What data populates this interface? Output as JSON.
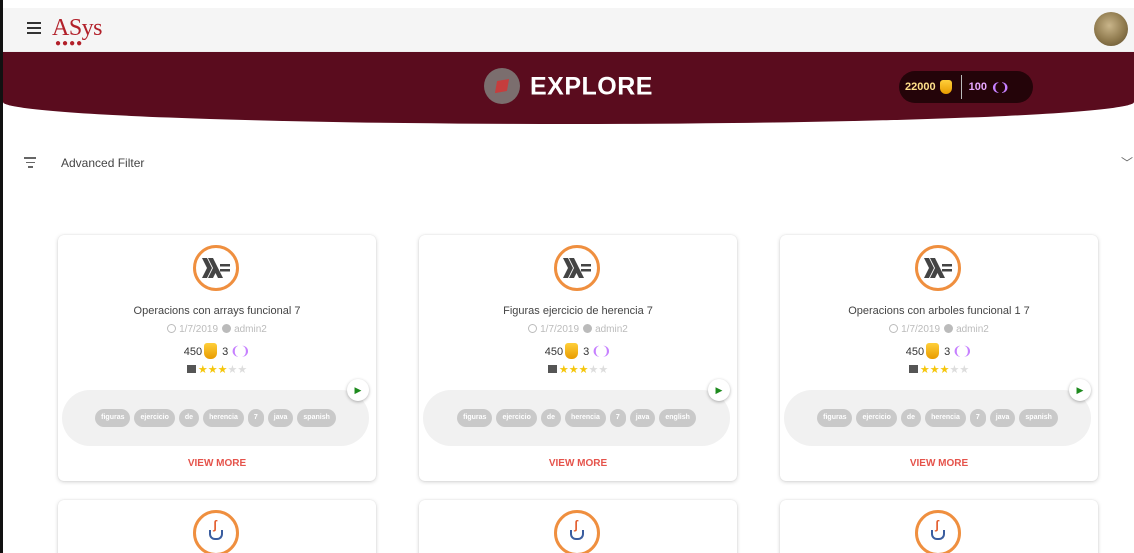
{
  "app": {
    "logo": "ASys",
    "logo_dots": "●●●●",
    "brand_color": "#b2202a"
  },
  "header": {
    "title": "EXPLORE",
    "banner_color": "#5a0c1e",
    "coins": "22000",
    "lives": "100"
  },
  "filter": {
    "label": "Advanced Filter"
  },
  "cards": [
    {
      "title": "Operacions con arrays funcional 7",
      "date": "1/7/2019",
      "author": "admin2",
      "coins": "450",
      "lives": "3",
      "rating": 3,
      "tags": [
        "figuras",
        "ejercicio",
        "de",
        "herencia",
        "7",
        "java",
        "spanish"
      ],
      "cta": "VIEW MORE",
      "icon": "haskell-icon"
    },
    {
      "title": "Figuras ejercicio de herencia 7",
      "date": "1/7/2019",
      "author": "admin2",
      "coins": "450",
      "lives": "3",
      "rating": 3,
      "tags": [
        "figuras",
        "ejercicio",
        "de",
        "herencia",
        "7",
        "java",
        "english"
      ],
      "cta": "VIEW MORE",
      "icon": "haskell-icon"
    },
    {
      "title": "Operacions con arboles funcional 1 7",
      "date": "1/7/2019",
      "author": "admin2",
      "coins": "450",
      "lives": "3",
      "rating": 3,
      "tags": [
        "figuras",
        "ejercicio",
        "de",
        "herencia",
        "7",
        "java",
        "spanish"
      ],
      "cta": "VIEW MORE",
      "icon": "haskell-icon"
    }
  ],
  "partial_cards": [
    {
      "icon": "java-icon"
    },
    {
      "icon": "java-icon"
    },
    {
      "icon": "java-icon"
    }
  ]
}
